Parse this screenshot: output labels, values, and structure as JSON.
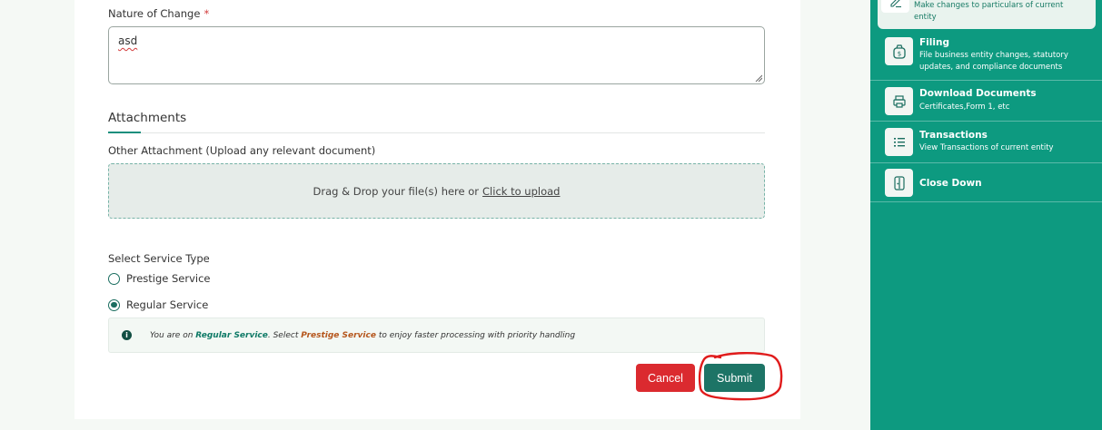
{
  "form": {
    "nature_label": "Nature of Change",
    "required_mark": "*",
    "nature_value": "asd",
    "attachments_title": "Attachments",
    "other_attachment_label": "Other Attachment (Upload any relevant document)",
    "dropzone_text": "Drag & Drop your file(s) here or",
    "dropzone_link": "Click to upload",
    "service_type_label": "Select Service Type",
    "service_options": [
      {
        "label": "Prestige Service",
        "selected": false
      },
      {
        "label": "Regular Service",
        "selected": true
      }
    ],
    "info": {
      "icon": "info-icon",
      "prefix": "You are on",
      "current": "Regular Service",
      "middle": ". Select",
      "upgrade": "Prestige Service",
      "suffix": "to enjoy faster processing with priority handling"
    },
    "cancel_label": "Cancel",
    "submit_label": "Submit"
  },
  "sidebar": {
    "active_item": {
      "icon": "edit-icon",
      "description": "Make changes to particulars of current entity"
    },
    "items": [
      {
        "icon": "money-bag-icon",
        "title": "Filing",
        "description": "File business entity changes, statutory updates, and compliance documents"
      },
      {
        "icon": "printer-icon",
        "title": "Download Documents",
        "description": "Certificates,Form 1, etc"
      },
      {
        "icon": "list-icon",
        "title": "Transactions",
        "description": "View Transactions of current entity"
      },
      {
        "icon": "door-exit-icon",
        "title": "Close Down",
        "description": ""
      }
    ]
  },
  "colors": {
    "sidebar_bg": "#0d9a80",
    "cancel": "#db2a2f",
    "submit": "#1d7466",
    "regular_highlight": "#0e7a66",
    "prestige_highlight": "#b5561c",
    "annotation": "#e01b1b"
  }
}
